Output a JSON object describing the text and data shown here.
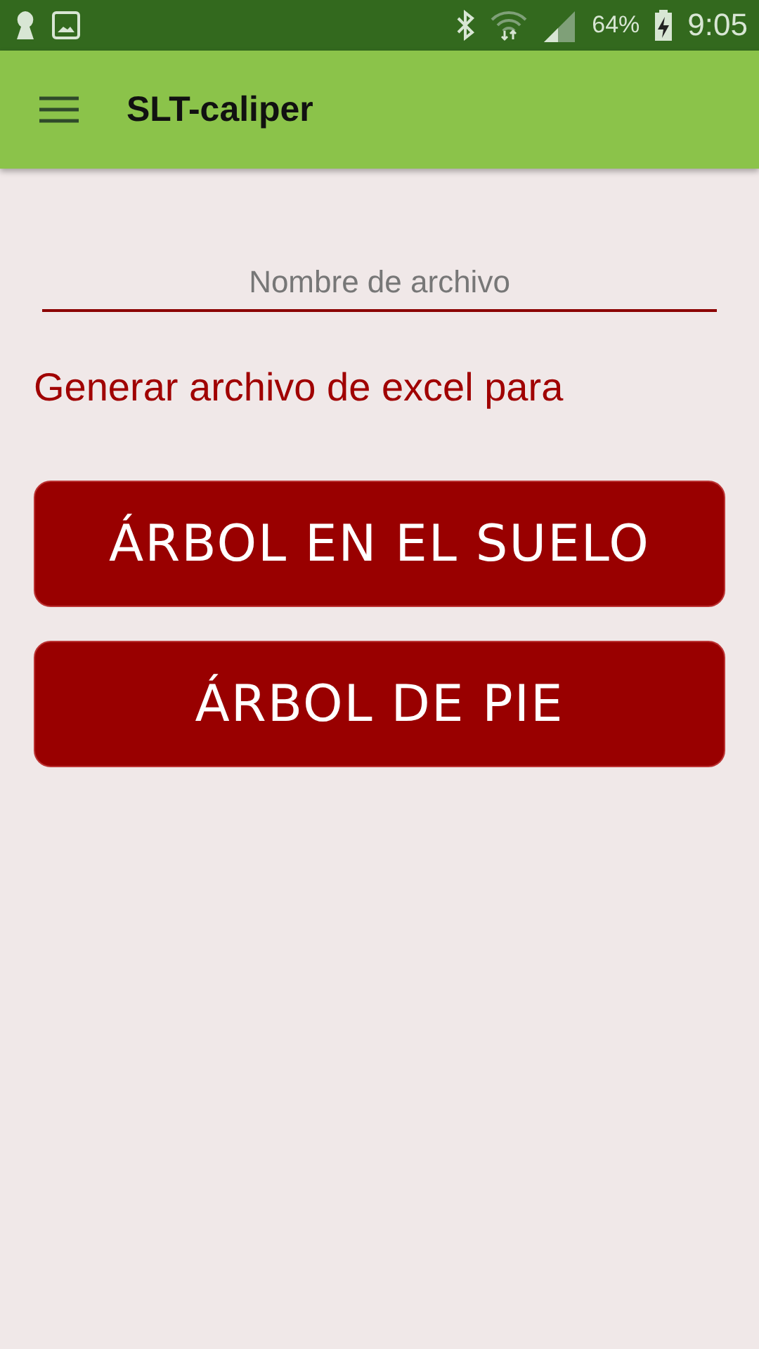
{
  "status_bar": {
    "battery": "64%",
    "time": "9:05"
  },
  "app_bar": {
    "title": "SLT-caliper"
  },
  "filename_field": {
    "placeholder": "Nombre de archivo"
  },
  "prompt": "Generar archivo de excel para",
  "buttons": [
    "ÁRBOL EN EL SUELO",
    "ÁRBOL DE PIE"
  ]
}
